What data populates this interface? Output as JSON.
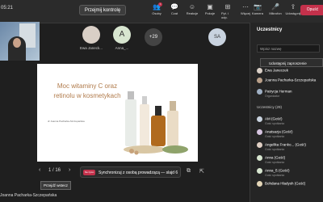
{
  "topbar": {
    "time": "05:21",
    "control_button": "Przejmij kontrolę",
    "icons": [
      {
        "name": "people-icon",
        "label": "Osoby",
        "badge": "3"
      },
      {
        "name": "chat-icon",
        "label": "Czat"
      },
      {
        "name": "reactions-icon",
        "label": "Reakcje"
      },
      {
        "name": "rooms-icon",
        "label": "Pokoje"
      },
      {
        "name": "apps-icon",
        "label": "Pyt. i odp."
      },
      {
        "name": "more-icon",
        "label": "Więcej"
      }
    ],
    "right_icons": [
      {
        "name": "camera-icon",
        "label": "Kamera"
      },
      {
        "name": "mic-icon",
        "label": "Mikrofon"
      },
      {
        "name": "share-icon",
        "label": "Udostępnij"
      }
    ],
    "leave_button": "Opuść"
  },
  "tiles": [
    {
      "label": "Ewa Janeck..."
    },
    {
      "initials": "A",
      "label": "Anna_..."
    },
    {
      "count": "+29"
    }
  ],
  "sa_tile": {
    "initials": "SA"
  },
  "slide": {
    "title": "Moc witaminy C oraz retinolu w kosmetykach",
    "author": "dr Joanna Pacharka-Szczepańska"
  },
  "page_counter": "1 / 16",
  "sync": {
    "badge": "Na żywo",
    "text": "Synchronizuj z osobą prowadzącą — slajd 6"
  },
  "presenter_name": "Joanna Pacharka-Szczepańska",
  "tooltip": "Przejdź wstecz",
  "panel": {
    "title": "Uczestnicy",
    "search_placeholder": "Wpisz nazwę",
    "share_invite": "Udostępnij zaproszenie",
    "top_rows": [
      {
        "name": "Ewa Janeczek",
        "sub": ""
      },
      {
        "name": "Joanna Pacharka-Szczepańska",
        "sub": ""
      },
      {
        "name": "Patrycja Herman",
        "sub": "Organizator"
      }
    ],
    "group_label": "Uczestnicy (29)",
    "attendees": [
      {
        "name": "AM (Gość)",
        "sub": "Gość spotkania"
      },
      {
        "name": "Anatsazja (Gość)",
        "sub": "Gość spotkania"
      },
      {
        "name": "Angelika Franko... (Gość)",
        "sub": "Gość spotkania"
      },
      {
        "name": "Anna (Gość)",
        "sub": "Gość spotkania"
      },
      {
        "name": "Anna_ß (Gość)",
        "sub": "Gość spotkania"
      },
      {
        "name": "Bohdana Hladysh (Gość)",
        "sub": ""
      }
    ]
  }
}
